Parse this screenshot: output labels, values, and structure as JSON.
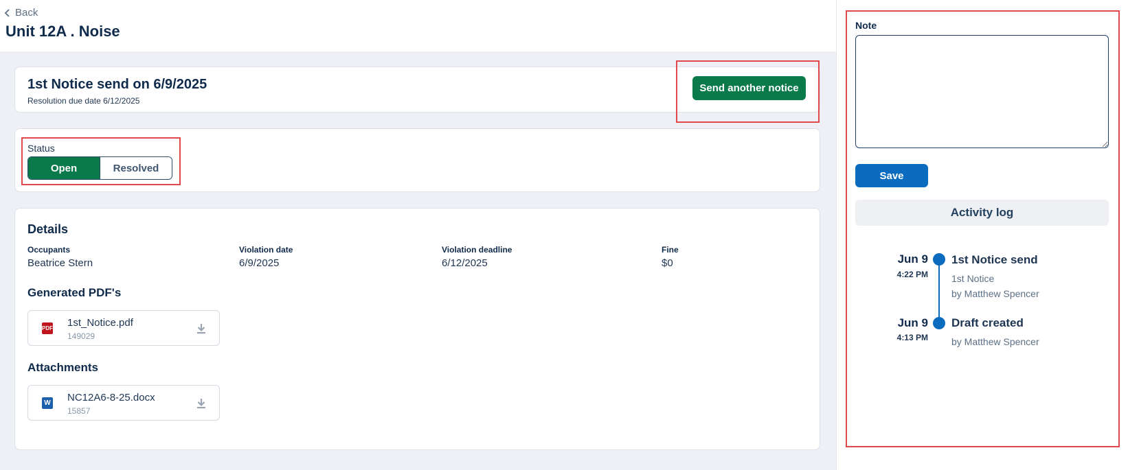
{
  "header": {
    "back_label": "Back",
    "title": "Unit 12A . Noise"
  },
  "notice": {
    "title": "1st Notice send on 6/9/2025",
    "subtitle": "Resolution due date 6/12/2025",
    "send_button": "Send another notice"
  },
  "status": {
    "label": "Status",
    "options": [
      "Open",
      "Resolved"
    ],
    "selected": "Open"
  },
  "details": {
    "heading": "Details",
    "fields": [
      {
        "label": "Occupants",
        "value": "Beatrice Stern"
      },
      {
        "label": "Violation date",
        "value": "6/9/2025"
      },
      {
        "label": "Violation deadline",
        "value": "6/12/2025"
      },
      {
        "label": "Fine",
        "value": "$0"
      }
    ]
  },
  "pdfs": {
    "heading": "Generated PDF's",
    "files": [
      {
        "name": "1st_Notice.pdf",
        "size": "149029",
        "icon": "pdf-icon",
        "icon_text": "PDF",
        "icon_color": "#c0141c"
      }
    ]
  },
  "attachments": {
    "heading": "Attachments",
    "files": [
      {
        "name": "NC12A6-8-25.docx",
        "size": "15857",
        "icon": "word-icon",
        "icon_text": "W",
        "icon_color": "#1b5fad"
      }
    ]
  },
  "note": {
    "label": "Note",
    "value": "",
    "save_button": "Save"
  },
  "activity": {
    "heading": "Activity log",
    "entries": [
      {
        "date": "Jun 9",
        "time": "4:22 PM",
        "title": "1st Notice send",
        "lines": [
          "1st Notice",
          "by Matthew Spencer"
        ]
      },
      {
        "date": "Jun 9",
        "time": "4:13 PM",
        "title": "Draft created",
        "lines": [
          "by Matthew Spencer"
        ]
      }
    ]
  },
  "colors": {
    "primary_green": "#0a7a4b",
    "primary_blue": "#0b6bbf",
    "highlight_red": "#e2474b",
    "text_navy": "#0f2a4a"
  }
}
